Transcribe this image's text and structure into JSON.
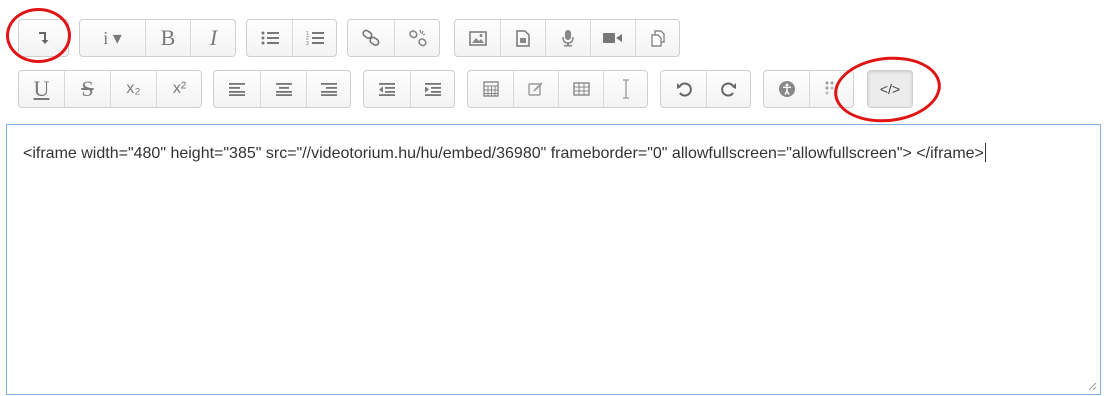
{
  "toolbar": {
    "row1": [
      {
        "name": "show-more-icon",
        "glyph": "↴"
      },
      {
        "name": "info-dropdown",
        "glyph": "i ▾"
      },
      {
        "name": "bold-button",
        "glyph": "B"
      },
      {
        "name": "italic-button",
        "glyph": "I"
      },
      {
        "name": "unordered-list-icon"
      },
      {
        "name": "ordered-list-icon"
      },
      {
        "name": "link-icon"
      },
      {
        "name": "unlink-icon"
      },
      {
        "name": "image-icon"
      },
      {
        "name": "media-icon"
      },
      {
        "name": "microphone-icon"
      },
      {
        "name": "video-icon"
      },
      {
        "name": "manage-files-icon"
      }
    ],
    "row2": [
      {
        "name": "underline-button",
        "glyph": "U"
      },
      {
        "name": "strikethrough-button",
        "glyph": "S"
      },
      {
        "name": "subscript-button",
        "glyph": "x₂"
      },
      {
        "name": "superscript-button",
        "glyph": "x²"
      },
      {
        "name": "align-left-icon"
      },
      {
        "name": "align-center-icon"
      },
      {
        "name": "align-right-icon"
      },
      {
        "name": "outdent-icon"
      },
      {
        "name": "indent-icon"
      },
      {
        "name": "equation-icon"
      },
      {
        "name": "special-char-icon"
      },
      {
        "name": "table-icon"
      },
      {
        "name": "clear-format-icon"
      },
      {
        "name": "undo-icon"
      },
      {
        "name": "redo-icon"
      },
      {
        "name": "accessibility-icon"
      },
      {
        "name": "screenreader-icon"
      },
      {
        "name": "html-source-button",
        "glyph": "</>"
      }
    ],
    "labels": {
      "info": "i ▾",
      "bold": "B",
      "italic": "I",
      "underline": "U",
      "strike": "S",
      "subscript": "x₂",
      "superscript": "x²",
      "html": "</>"
    }
  },
  "editor": {
    "content": "<iframe width=\"480\" height=\"385\" src=\"//videotorium.hu/hu/embed/36980\" frameborder=\"0\" allowfullscreen=\"allowfullscreen\"> </iframe>"
  },
  "annotations": {
    "highlight_color": "#e01414"
  },
  "colors": {
    "icon": "#7a7a7a",
    "editor_border": "#7fb0e3"
  }
}
